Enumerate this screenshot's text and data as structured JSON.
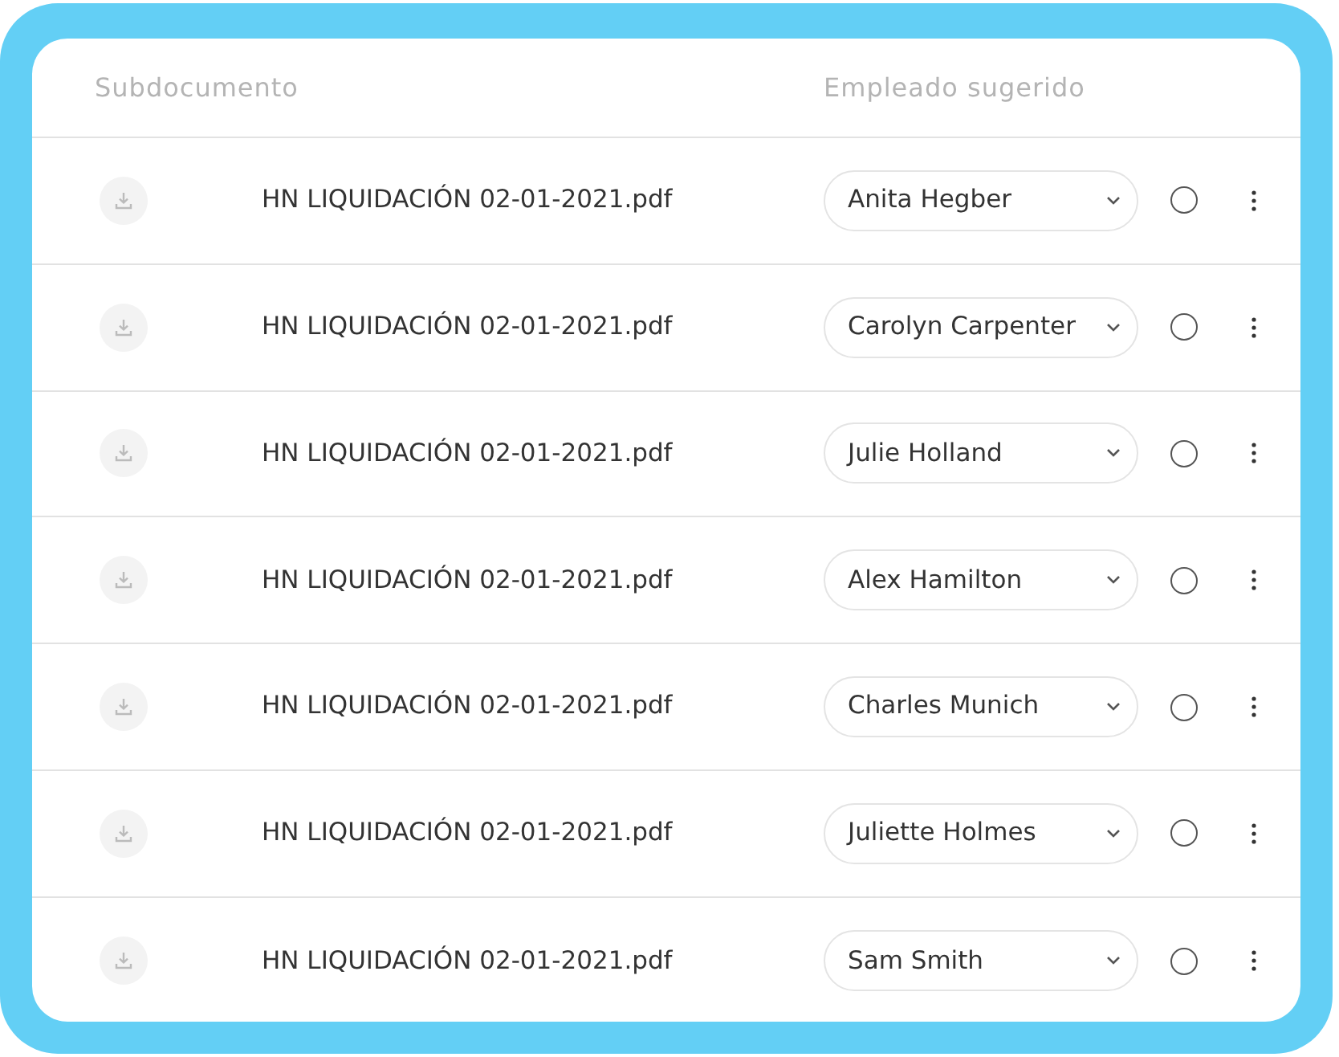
{
  "columns": [
    "Subdocumento",
    "Empleado sugerido"
  ],
  "rows": [
    {
      "file": "HN LIQUIDACIÓN 02-01-2021.pdf",
      "employee": "Anita Hegber",
      "selected": false
    },
    {
      "file": "HN LIQUIDACIÓN 02-01-2021.pdf",
      "employee": "Carolyn Carpenter",
      "selected": false
    },
    {
      "file": "HN LIQUIDACIÓN 02-01-2021.pdf",
      "employee": "Julie Holland",
      "selected": false
    },
    {
      "file": "HN LIQUIDACIÓN 02-01-2021.pdf",
      "employee": "Alex Hamilton",
      "selected": false
    },
    {
      "file": "HN LIQUIDACIÓN 02-01-2021.pdf",
      "employee": "Charles Munich",
      "selected": false
    },
    {
      "file": "HN LIQUIDACIÓN 02-01-2021.pdf",
      "employee": "Juliette Holmes",
      "selected": false
    },
    {
      "file": "HN LIQUIDACIÓN 02-01-2021.pdf",
      "employee": "Sam Smith",
      "selected": false
    }
  ]
}
